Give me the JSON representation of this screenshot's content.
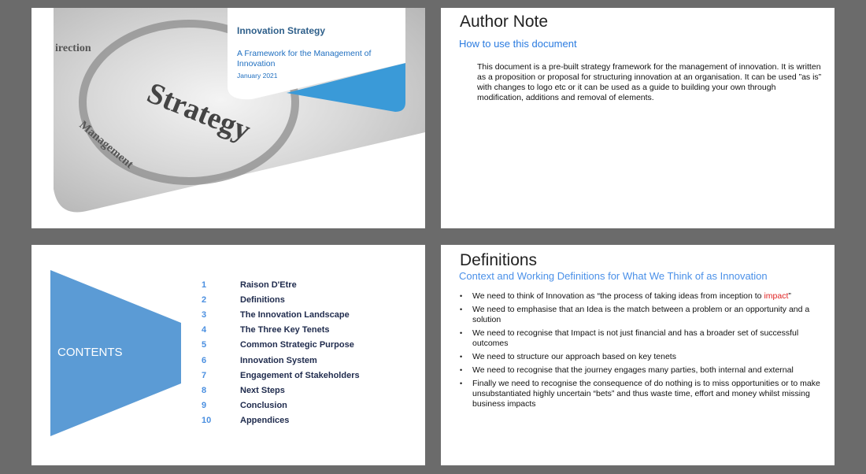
{
  "slides": [
    {
      "title": "Innovation Strategy",
      "subtitle": "A Framework for the Management of Innovation",
      "date": "January 2021"
    },
    {
      "title": "Author Note",
      "subtitle": "How to use this document",
      "body": "This document is a pre-built strategy framework for the management of innovation. It is written as a proposition or proposal for structuring innovation at an organisation. It can be used ”as is” with changes to logo etc or it can be used as a guide to building your own through modification, additions and removal of elements."
    },
    {
      "label": "CONTENTS",
      "items": [
        {
          "num": "1",
          "label": "Raison D'Etre"
        },
        {
          "num": "2",
          "label": "Definitions"
        },
        {
          "num": "3",
          "label": "The Innovation Landscape"
        },
        {
          "num": "4",
          "label": "The Three Key Tenets"
        },
        {
          "num": "5",
          "label": "Common Strategic Purpose"
        },
        {
          "num": "6",
          "label": "Innovation System"
        },
        {
          "num": "7",
          "label": "Engagement of Stakeholders"
        },
        {
          "num": "8",
          "label": "Next Steps"
        },
        {
          "num": "9",
          "label": "Conclusion"
        },
        {
          "num": "10",
          "label": "Appendices"
        }
      ]
    },
    {
      "title": "Definitions",
      "subtitle": "Context and Working Definitions for What We Think of as Innovation",
      "bullet1_pre": "We need to think of Innovation as “the process of taking ideas from inception to ",
      "bullet1_red": "impact",
      "bullet1_post": "”",
      "bullets": [
        "We need to emphasise that an Idea is the match between a problem or an opportunity and a solution",
        "We need to recognise that Impact is not just financial and has a broader set of successful outcomes",
        "We need to structure our approach based on key tenets",
        "We need to recognise that the journey engages many parties, both internal and external",
        "Finally we need to recognise the consequence of do nothing is to miss opportunities or to make unsubstantiated highly uncertain “bets” and thus waste time, effort and money whilst missing business impacts"
      ]
    }
  ],
  "colors": {
    "accent_blue": "#3a9ad8",
    "contents_shape": "#5b9bd5",
    "highlight_red": "#e02020"
  }
}
